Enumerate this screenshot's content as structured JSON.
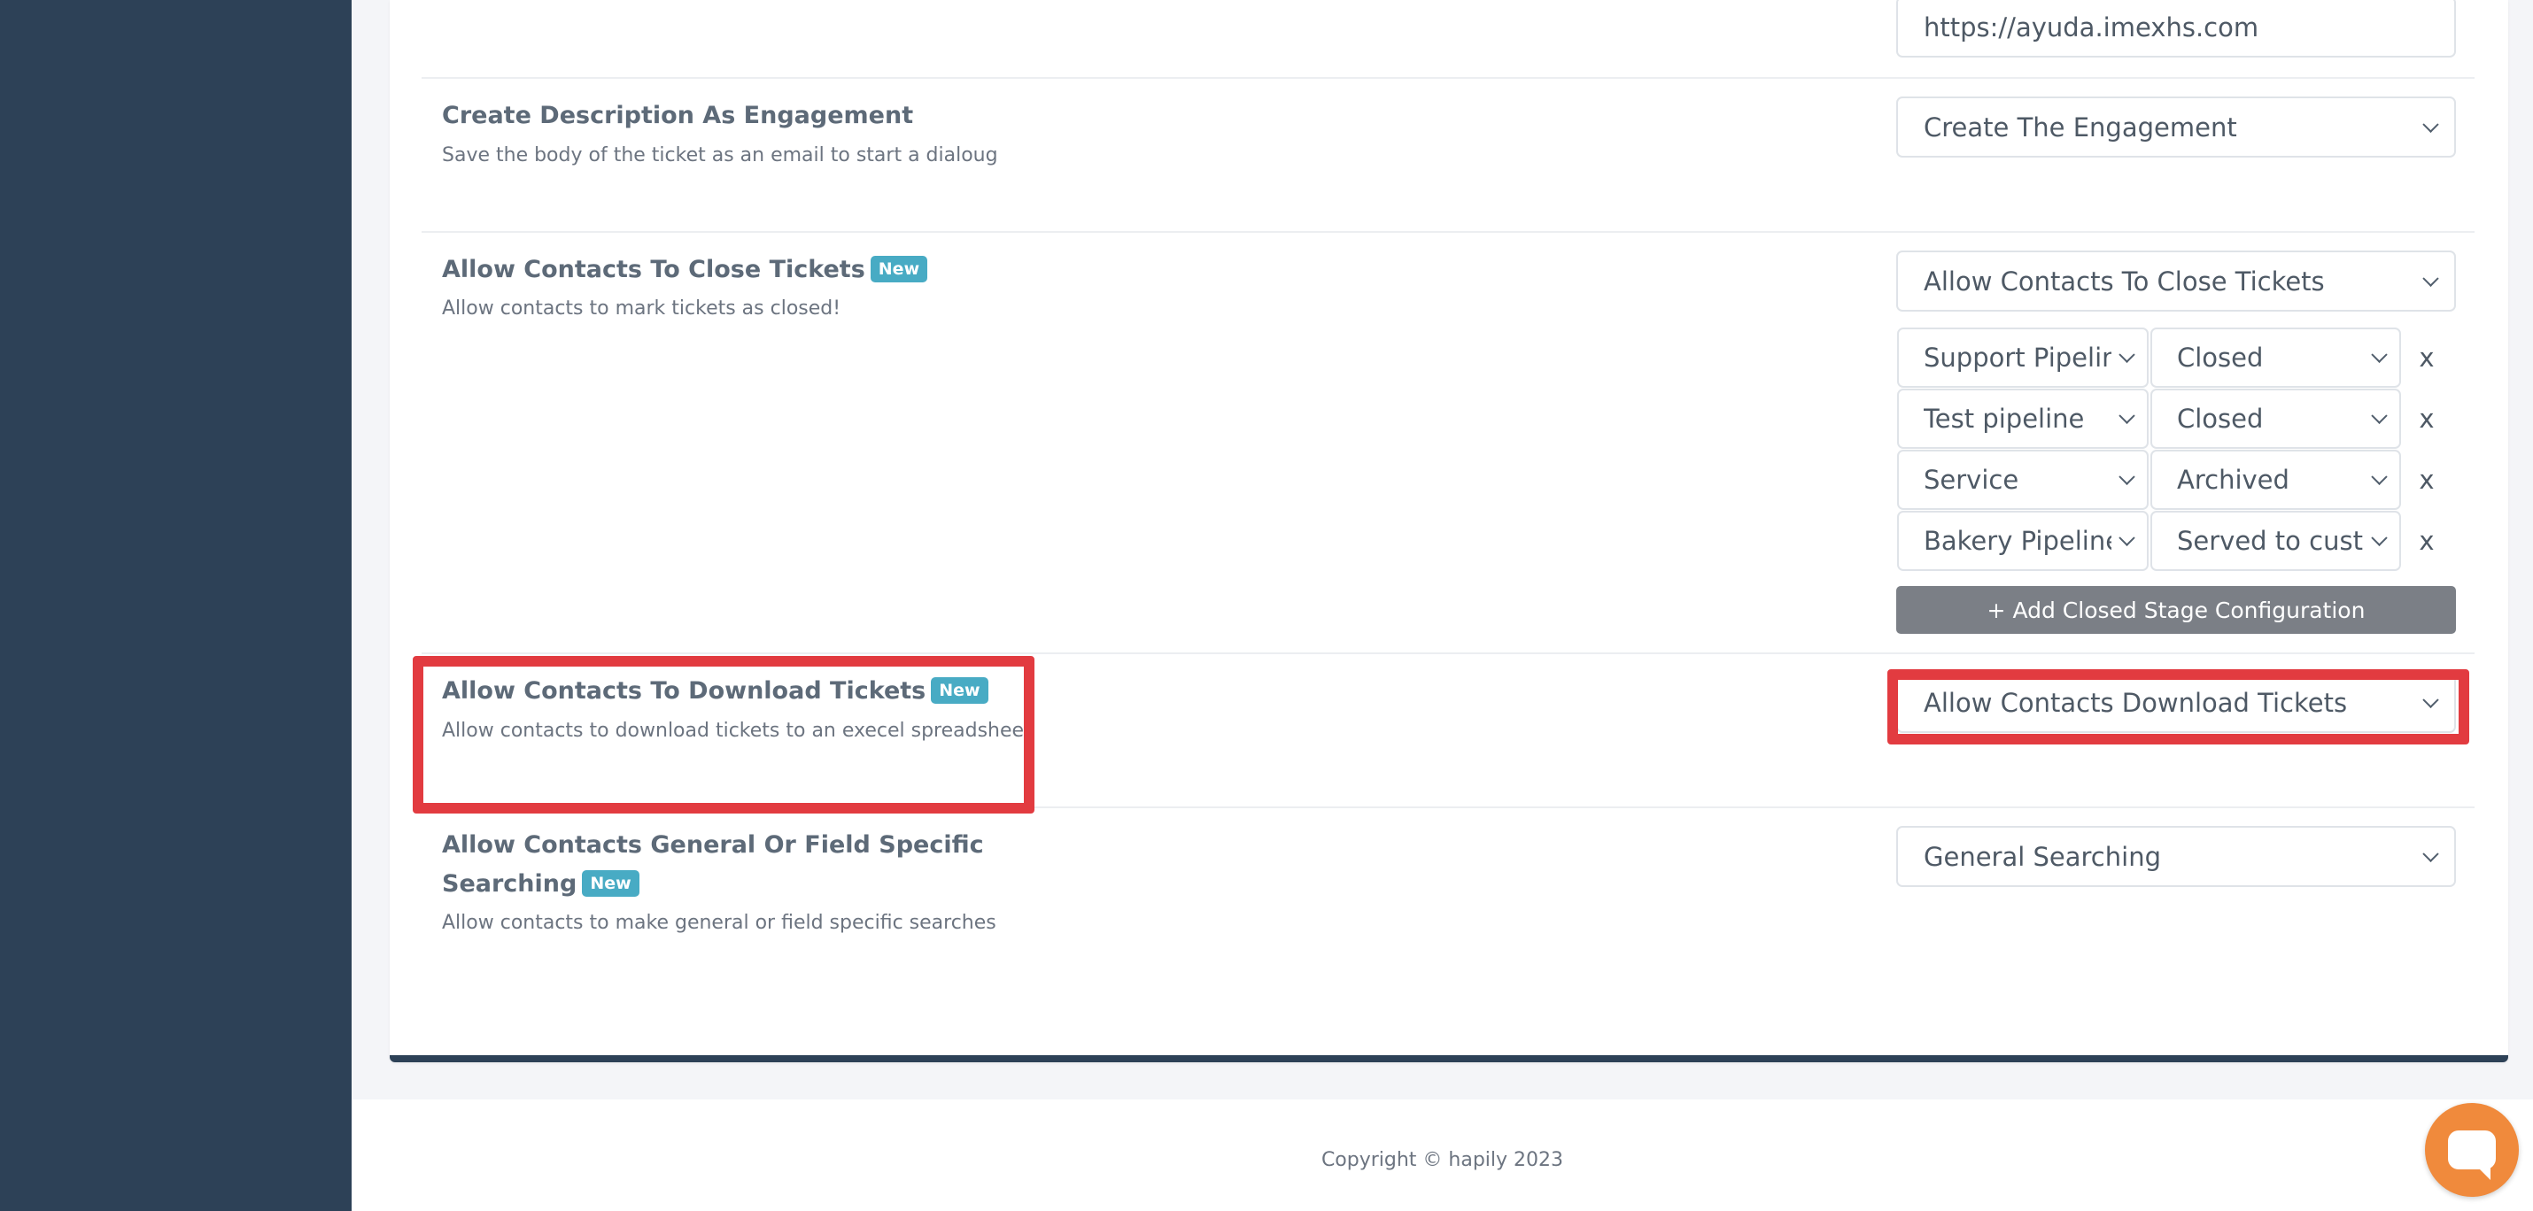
{
  "settings": {
    "help_url": {
      "value": "https://ayuda.imexhs.com"
    },
    "create_description": {
      "title": "Create Description As Engagement",
      "description": "Save the body of the ticket as an email to start a dialoug",
      "selected": "Create The Engagement"
    },
    "close_tickets": {
      "title": "Allow Contacts To Close Tickets",
      "badge": "New",
      "description": "Allow contacts to mark tickets as closed!",
      "selected": "Allow Contacts To Close Tickets",
      "stage_rows": [
        {
          "pipeline": "Support Pipelin",
          "stage": "Closed",
          "remove": "x"
        },
        {
          "pipeline": "Test pipeline",
          "stage": "Closed",
          "remove": "x"
        },
        {
          "pipeline": "Service",
          "stage": "Archived",
          "remove": "x"
        },
        {
          "pipeline": "Bakery Pipeline",
          "stage": "Served to custo",
          "remove": "x"
        }
      ],
      "add_button": "+ Add Closed Stage Configuration"
    },
    "download_tickets": {
      "title": "Allow Contacts To Download Tickets",
      "badge": "New",
      "description": "Allow contacts to download tickets to an execel spreadsheet",
      "selected": "Allow Contacts Download Tickets"
    },
    "searching": {
      "title_line1": "Allow Contacts General Or Field Specific",
      "title_line2": "Searching",
      "badge": "New",
      "description": "Allow contacts to make general or field specific searches",
      "selected": "General Searching"
    }
  },
  "footer": {
    "copyright": "Copyright © hapily 2023"
  },
  "colors": {
    "sidebar": "#2d4157",
    "badge": "#48abc4",
    "highlight": "#e23b40",
    "chat": "#f08a3c",
    "add_button": "#7b7f86"
  }
}
